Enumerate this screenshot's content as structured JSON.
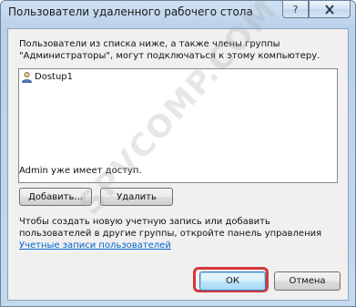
{
  "window": {
    "title": "Пользователи удаленного рабочего стола",
    "help_label": "?",
    "close_label": "X"
  },
  "dialog": {
    "description": "Пользователи из списка ниже, а также члены группы \"Администраторы\", могут подключаться к этому компьютеру.",
    "users": [
      {
        "name": "Dostup1",
        "icon": "user-icon"
      }
    ],
    "access_note": "Admin уже имеет доступ.",
    "add_label": "Добавить...",
    "remove_label": "Удалить",
    "info_text": "Чтобы создать новую учетную запись или добавить пользователей в другие группы, откройте панель управления ",
    "info_link": "Учетные записи пользователей",
    "ok_label": "ОК",
    "cancel_label": "Отмена"
  },
  "watermark": {
    "text": "SPVCOMP.COM"
  },
  "colors": {
    "highlight": "#d4373d",
    "link": "#0066cc"
  }
}
